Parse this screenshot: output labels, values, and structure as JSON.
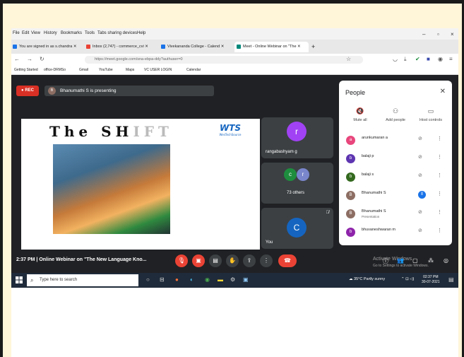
{
  "menu": [
    "File",
    "Edit",
    "View",
    "History",
    "Bookmarks",
    "Tools",
    "Tabs sharing devices",
    "Help"
  ],
  "tabs": [
    {
      "label": "You are signed in as s.chandra ✕",
      "color": "#1a73e8"
    },
    {
      "label": "Inbox (2,747) - commerce_cvi ✕",
      "color": "#ea4335"
    },
    {
      "label": "Vivekananda College - Calend ✕",
      "color": "#1a73e8"
    },
    {
      "label": "Meet - Online Webinar on \"The ✕",
      "color": "#00897b",
      "active": true
    }
  ],
  "url": "https://meet.google.com/sna-ebpa-ddy?authuser=0",
  "bookmarks": [
    "Getting Started",
    "office-DRMSo",
    "Gmail",
    "YouTube",
    "Maps",
    "VC USER LOGIN",
    "Calendar"
  ],
  "meet": {
    "rec_label": "REC",
    "presenting_initial": "B",
    "presenting_text": "Bhanumathi S is presenting",
    "slide_title_dark": "The SH",
    "slide_title_fade": "IFT",
    "slide_logo": "WTS",
    "slide_logo_sub": "WesTechSource",
    "tiles": [
      {
        "name": "rangabashyam g",
        "initial": "r",
        "color": "#a142f4"
      },
      {
        "name": "73 others",
        "initials": [
          "c",
          "r"
        ],
        "colors": [
          "#1e8e3e",
          "#7986cb"
        ]
      },
      {
        "name": "You",
        "initial": "C",
        "color": "#1565c0"
      }
    ],
    "meeting_time": "2:37 PM",
    "meeting_title": "Online Webinar on \"The New Language Kno...",
    "activate_line1": "Activate Windows",
    "activate_line2": "Go to Settings to activate Windows."
  },
  "people": {
    "title": "People",
    "actions": [
      "Mute all",
      "Add people",
      "Host controls"
    ],
    "list": [
      {
        "name": "arunkumaran a",
        "initial": "a",
        "color": "#e8467c"
      },
      {
        "name": "balaji p",
        "initial": "b",
        "color": "#5e35b1"
      },
      {
        "name": "balaji s",
        "initial": "b",
        "color": "#33691e"
      },
      {
        "name": "Bhanumathi S",
        "initial": "B",
        "color": "#8d6e63",
        "speaking": true
      },
      {
        "name": "Bhanumathi S",
        "sub": "Presentation",
        "initial": "B",
        "color": "#8d6e63"
      },
      {
        "name": "bhuvaneshwaran m",
        "initial": "b",
        "color": "#8e24aa"
      }
    ]
  },
  "taskbar": {
    "search_placeholder": "Type here to search",
    "weather": "35°C  Partly sunny",
    "time": "02:37 PM",
    "date": "30-07-2021"
  }
}
